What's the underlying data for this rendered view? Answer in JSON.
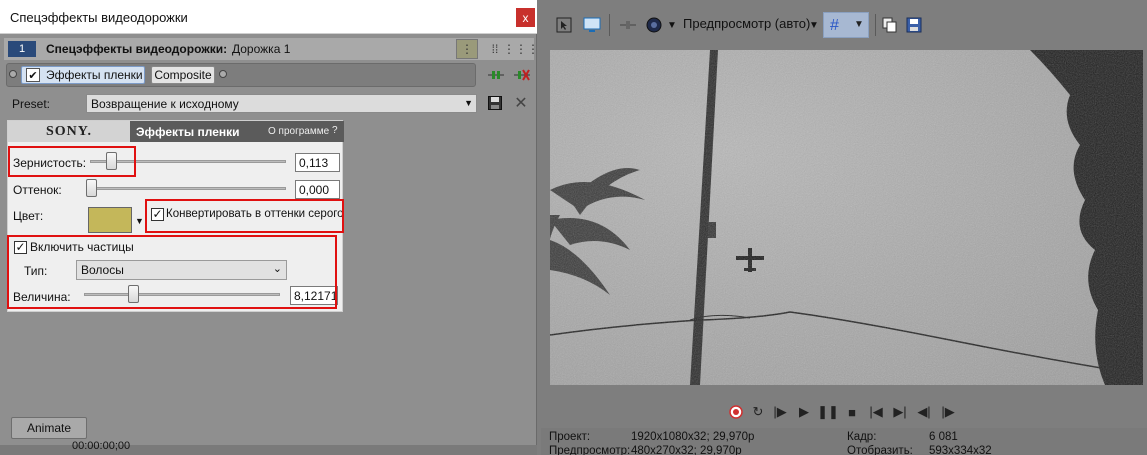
{
  "dialog": {
    "title": "Спецэффекты видеодорожки",
    "close_label": "x",
    "header": {
      "track_number": "1",
      "title": "Спецэффекты видеодорожки:",
      "track_name": "Дорожка 1"
    },
    "chain": [
      {
        "label": "Эффекты пленки",
        "checked": true,
        "selected": true
      },
      {
        "label": "Composite",
        "checked": false,
        "selected": false
      }
    ],
    "preset": {
      "label": "Preset:",
      "value": "Возвращение к исходному"
    },
    "plugin": {
      "logo_text": "SONY.",
      "name": "Эффекты пленки",
      "about": "О программе",
      "help": "?",
      "grain": {
        "label": "Зернистость:",
        "value": "0,113"
      },
      "tint": {
        "label": "Оттенок:",
        "value": "0,000"
      },
      "color": {
        "label": "Цвет:",
        "swatch": "#c4b75a"
      },
      "grayscale": {
        "label": "Конвертировать в оттенки серого",
        "checked": true
      },
      "particles": {
        "label": "Включить частицы",
        "checked": true,
        "type_label": "Тип:",
        "type_value": "Волосы",
        "size_label": "Величина:",
        "size_value": "8,12171"
      }
    },
    "animate_label": "Animate",
    "timeline_timecode": "00:00:00;00"
  },
  "preview": {
    "mode_label": "Предпросмотр (авто)",
    "info": {
      "project_label": "Проект:",
      "project_value": "1920x1080x32; 29,970p",
      "preview_label": "Предпросмотр:",
      "preview_value": "480x270x32; 29,970p",
      "frame_label": "Кадр:",
      "frame_value": "6 081",
      "display_label": "Отобразить:",
      "display_value": "593x334x32"
    }
  },
  "colors": {
    "highlight": "#e01010",
    "record": "#d03030",
    "plugin_header": "#5b5b5b"
  }
}
